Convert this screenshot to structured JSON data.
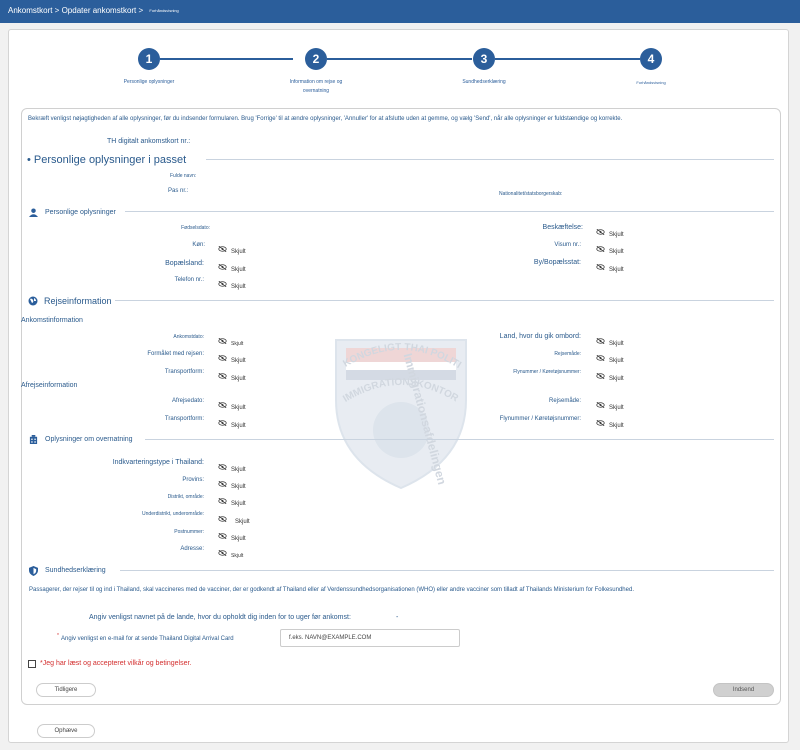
{
  "breadcrumb": {
    "part1": "Ankomstkort > Opdater ankomstkort >",
    "part3": "Forhåndsvisning"
  },
  "steps": [
    {
      "num": "1",
      "label": "Personlige oplysninger"
    },
    {
      "num": "2",
      "label_l1": "Information om rejse og",
      "label_l2": "overnatning"
    },
    {
      "num": "3",
      "label": "Sundhedserklæring"
    },
    {
      "num": "4",
      "label": "Forhåndsvisning"
    }
  ],
  "intro": "Bekræft venligst nøjagtigheden af alle oplysninger, før du indsender formularen. Brug 'Forrige' til at ændre oplysninger, 'Annuller' for at afslutte uden at gemme, og vælg 'Send', når alle oplysninger er fuldstændige og korrekte.",
  "arrival_card_no_label": "TH digitalt ankomstkort nr.:",
  "passport": {
    "title": "• Personlige oplysninger i passet",
    "full_name": "Fulde navn:",
    "passport_no": "Pas nr.:",
    "nationality": "Nationalitet/statsborgerskab:"
  },
  "personal": {
    "title": "Personlige oplysninger",
    "birth": "Fødselsdato:",
    "occupation": "Beskæftelse:",
    "gender": "Køn:",
    "visa": "Visum nr.:",
    "residence_country": "Bopælsland:",
    "residence_city": "By/Bopælsstat:",
    "phone": "Telefon nr.:"
  },
  "hidden": "Skjult",
  "travel": {
    "title": "Rejseinformation",
    "arrival_head": "Ankomstinformation",
    "arrival_date": "Ankomstdato:",
    "boarding_country": "Land, hvor du gik ombord:",
    "purpose": "Formålet med rejsen:",
    "travel_mode": "Rejsemåde:",
    "transport": "Transportform:",
    "flight_no": "Flynummer / Køretøjsnummer:",
    "departure_head": "Afrejseinformation",
    "departure_date": "Afrejsedato:"
  },
  "accommodation": {
    "title": "Oplysninger om overnatning",
    "type": "Indkvarteringstype i Thailand:",
    "province": "Provins:",
    "district": "Distrikt, område:",
    "subdistrict": "Underdistrikt, underområde:",
    "postcode": "Postnummer:",
    "address": "Adresse:"
  },
  "health": {
    "title": "Sundhedserklæring",
    "text": "Passagerer, der rejser til og ind i Thailand, skal vaccineres med de vacciner, der er godkendt af Thailand eller af Verdenssundhedsorganisationen (WHO) eller andre vacciner som tilladt af Thailands Ministerium for Folkesundhed.",
    "countries_label": "Angiv venligst navnet på de lande, hvor du opholdt dig inden for to uger før ankomst:",
    "countries_value": "-",
    "email_label": "Angiv venligst en e-mail for at sende Thailand Digital Arrival Card",
    "email_required": "*",
    "email_placeholder": "f.eks. NAVN@EXAMPLE.COM"
  },
  "terms": "*Jeg har læst og accepteret vilkår og betingelser.",
  "buttons": {
    "previous": "Tidligere",
    "submit": "Indsend",
    "cancel": "Ophæve"
  },
  "watermark": {
    "line1": "KONGELIGT THAI POLITI",
    "line2": "IMMIGRATIONSKONTOR",
    "line3": "Immigrationsafdelingen"
  },
  "colors": {
    "primary": "#2b5e9b",
    "required": "#d32f2f"
  }
}
